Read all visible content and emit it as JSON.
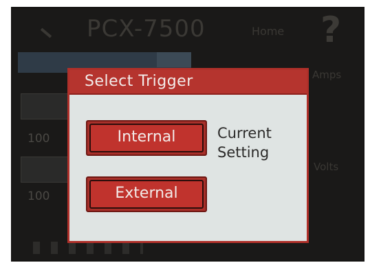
{
  "background_app": {
    "title": "PCX-7500",
    "nav_home": "Home",
    "help_glyph": "?",
    "side_amps": "Amps",
    "side_volts": "Volts",
    "cells": [
      "100",
      "100"
    ]
  },
  "dialog": {
    "title": "Select Trigger",
    "options": [
      {
        "label": "Internal",
        "selected": true
      },
      {
        "label": "External",
        "selected": false
      }
    ],
    "current_setting_line1": "Current",
    "current_setting_line2": "Setting"
  },
  "colors": {
    "accent_red": "#b5342e",
    "dialog_bg": "#dfe4e3"
  }
}
